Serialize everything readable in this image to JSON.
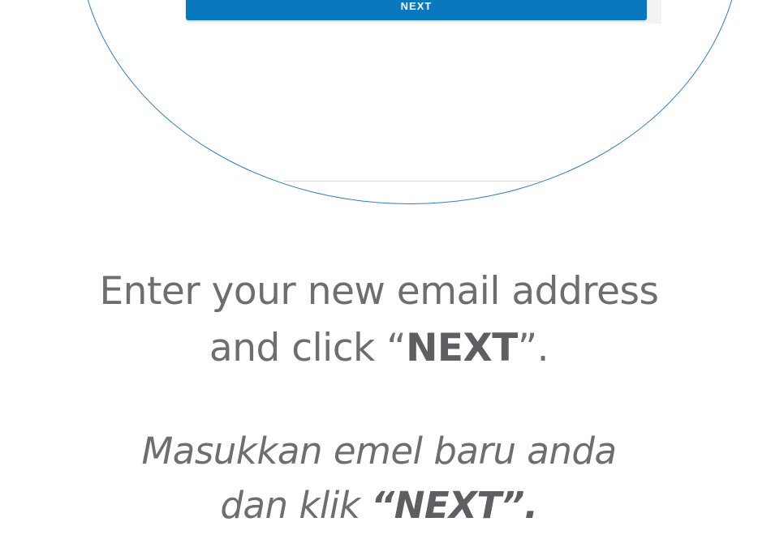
{
  "magnified_view": {
    "next_button_label": "NEXT"
  },
  "instructions": {
    "english": {
      "line1": "Enter your new email address",
      "line2_prefix": "and click “",
      "line2_bold": "NEXT",
      "line2_suffix": "”."
    },
    "malay": {
      "line1": "Masukkan emel baru anda",
      "line2_prefix": "dan klik ",
      "line2_bold": "“NEXT”."
    }
  },
  "colors": {
    "button_blue": "#0a78bd",
    "circle_outline": "#2f7fbf",
    "text_gray": "#6d6e71"
  }
}
